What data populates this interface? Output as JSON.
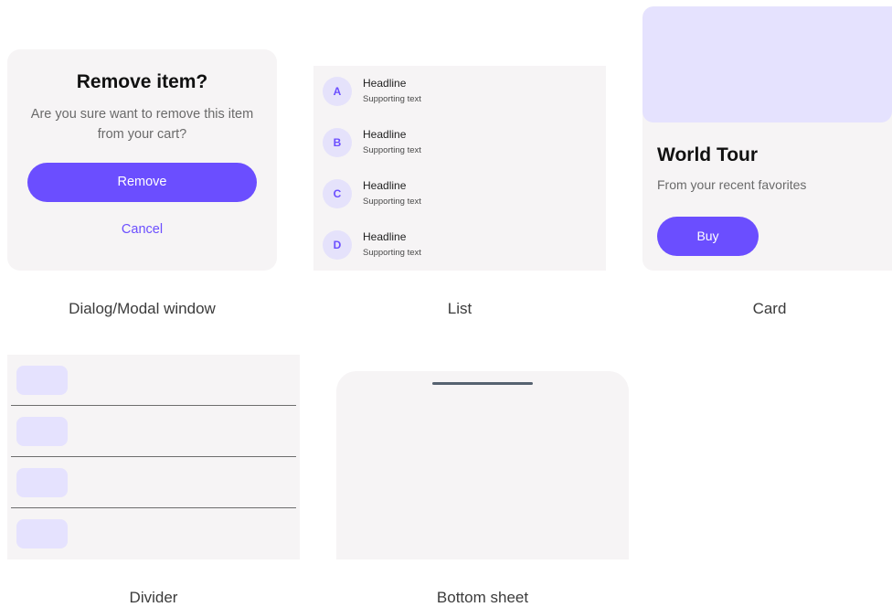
{
  "dialog": {
    "title": "Remove item?",
    "message": "Are you sure want to remove this item from your cart?",
    "primary_label": "Remove",
    "secondary_label": "Cancel",
    "caption": "Dialog/Modal window"
  },
  "list": {
    "items": [
      {
        "avatar": "A",
        "headline": "Headline",
        "supporting": "Supporting text"
      },
      {
        "avatar": "B",
        "headline": "Headline",
        "supporting": "Supporting text"
      },
      {
        "avatar": "C",
        "headline": "Headline",
        "supporting": "Supporting text"
      },
      {
        "avatar": "D",
        "headline": "Headline",
        "supporting": "Supporting text"
      }
    ],
    "caption": "List"
  },
  "card": {
    "title": "World Tour",
    "subtitle": "From your recent favorites",
    "button_label": "Buy",
    "caption": "Card"
  },
  "divider": {
    "caption": "Divider"
  },
  "bottom_sheet": {
    "caption": "Bottom sheet"
  },
  "colors": {
    "accent": "#6b4eff",
    "surface": "#f6f4f5",
    "accent_light": "#e5e2fe",
    "handle": "#566270"
  }
}
